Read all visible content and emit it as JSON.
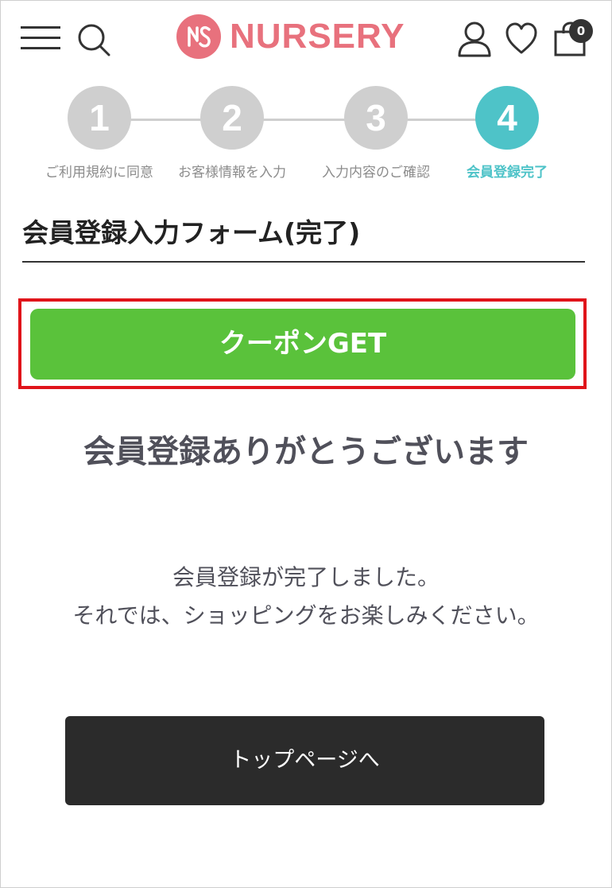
{
  "header": {
    "logo_text": "NURSERY",
    "brand_color": "#e8717d",
    "icons": [
      "menu-icon",
      "search-icon",
      "user-icon",
      "heart-icon",
      "cart-icon"
    ],
    "cart_count": "0"
  },
  "stepper": {
    "steps": [
      {
        "number": "1",
        "label": "ご利用規約に同意",
        "active": false
      },
      {
        "number": "2",
        "label": "お客様情報を入力",
        "active": false
      },
      {
        "number": "3",
        "label": "入力内容のご確認",
        "active": false
      },
      {
        "number": "4",
        "label": "会員登録完了",
        "active": true
      }
    ],
    "active_color": "#4ec3c8",
    "inactive_color": "#cfcfcf"
  },
  "form_title": "会員登録入力フォーム(完了)",
  "coupon": {
    "label": "クーポンGET",
    "color": "#5ac23b",
    "highlight_color": "#e0141a"
  },
  "thanks_heading": "会員登録ありがとうございます",
  "message": {
    "line1": "会員登録が完了しました。",
    "line2": "それでは、ショッピングをお楽しみください。"
  },
  "top_button": {
    "label": "トップページへ"
  }
}
